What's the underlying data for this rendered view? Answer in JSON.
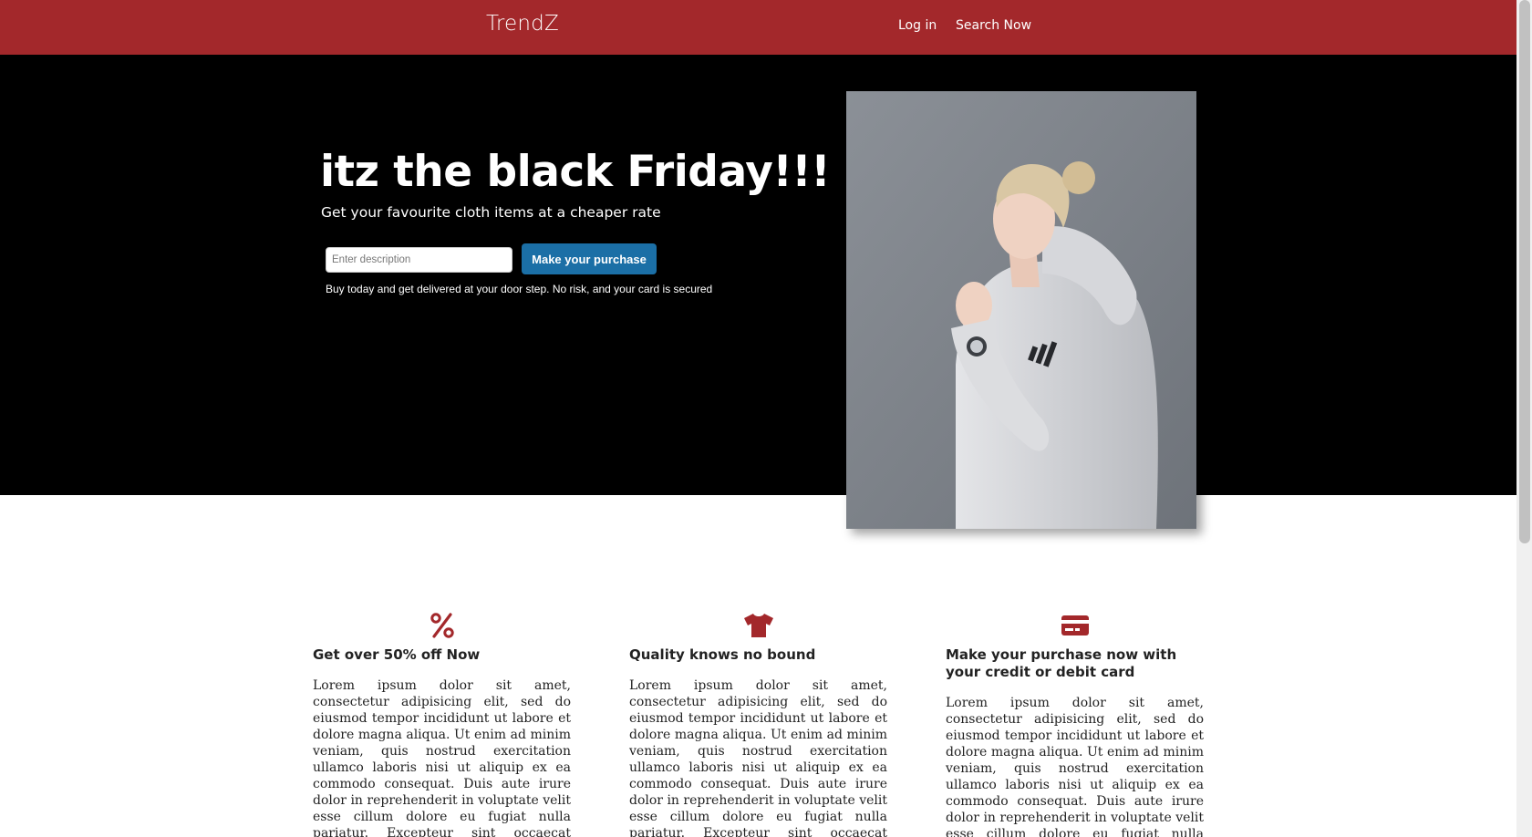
{
  "nav": {
    "brand": "TrendZ",
    "links": [
      "Log in",
      "Search Now"
    ]
  },
  "hero": {
    "title": "itz the black Friday!!!",
    "subtitle": "Get your favourite cloth items at a cheaper rate",
    "input_placeholder": "Enter description",
    "input_value": "",
    "button_label": "Make your purchase",
    "note": "Buy today and get delivered at your door step. No risk, and your card is secured",
    "image": "woman-in-white-adidas-hoodie"
  },
  "features": [
    {
      "icon": "percent-icon",
      "title": "Get over 50% off Now",
      "text": "Lorem ipsum dolor sit amet, consectetur adipisicing elit, sed do eiusmod tempor incididunt ut labore et dolore magna aliqua. Ut enim ad minim veniam, quis nostrud exercitation ullamco laboris nisi ut aliquip ex ea commodo consequat. Duis aute irure dolor in reprehenderit in voluptate velit esse cillum dolore eu fugiat nulla pariatur. Excepteur sint occaecat cupidatat non proident, sunt in culpa qui"
    },
    {
      "icon": "tshirt-icon",
      "title": "Quality knows no bound",
      "text": "Lorem ipsum dolor sit amet, consectetur adipisicing elit, sed do eiusmod tempor incididunt ut labore et dolore magna aliqua. Ut enim ad minim veniam, quis nostrud exercitation ullamco laboris nisi ut aliquip ex ea commodo consequat. Duis aute irure dolor in reprehenderit in voluptate velit esse cillum dolore eu fugiat nulla pariatur. Excepteur sint occaecat cupidatat non proident, sunt in culpa qui"
    },
    {
      "icon": "credit-card-icon",
      "title": "Make your purchase now with your credit or debit card",
      "text": "Lorem ipsum dolor sit amet, consectetur adipisicing elit, sed do eiusmod tempor incididunt ut labore et dolore magna aliqua. Ut enim ad minim veniam, quis nostrud exercitation ullamco laboris nisi ut aliquip ex ea commodo consequat. Duis aute irure dolor in reprehenderit in voluptate velit esse cillum dolore eu fugiat nulla pariatur. Excepteur sint occaecat"
    }
  ],
  "colors": {
    "navbar": "#a3282b",
    "hero_bg": "#000000",
    "button": "#1b6fa6",
    "icon_accent": "#a3282b"
  }
}
